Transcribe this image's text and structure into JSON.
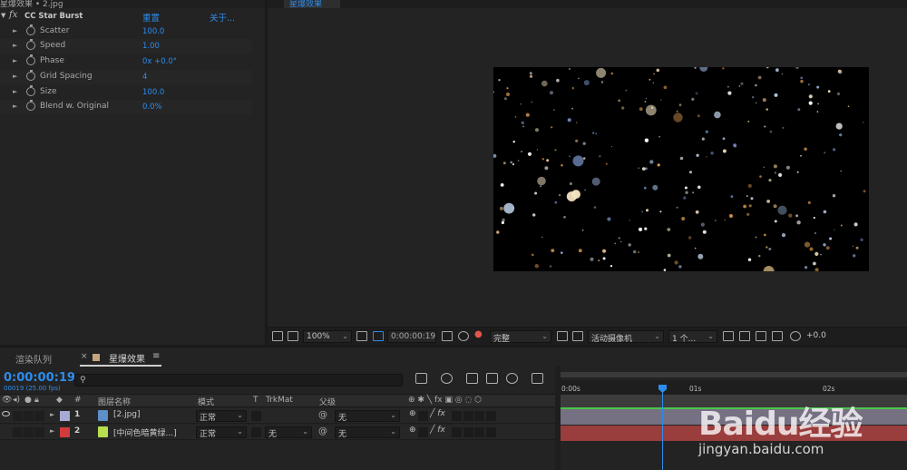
{
  "effect_panel": {
    "tab_title": "星爆效果 • 2.jpg",
    "effect_name": "CC Star Burst",
    "reset_label": "重置",
    "about_label": "关于...",
    "properties": [
      {
        "label": "Scatter",
        "value": "100.0"
      },
      {
        "label": "Speed",
        "value": "1.00"
      },
      {
        "label": "Phase",
        "value": "0x +0.0°"
      },
      {
        "label": "Grid Spacing",
        "value": "4"
      },
      {
        "label": "Size",
        "value": "100.0"
      },
      {
        "label": "Blend w. Original",
        "value": "0.0%"
      }
    ]
  },
  "viewer": {
    "comp_tab": "星爆效果",
    "toolbar": {
      "zoom": "100%",
      "timecode": "0:00:00:19",
      "resolution": "完整",
      "camera": "活动摄像机",
      "views": "1 个...",
      "exposure": "+0.0"
    }
  },
  "timeline": {
    "tab_render_queue": "渲染队列",
    "tab_comp": "星爆效果",
    "timecode": "0:00:00:19",
    "frame_info": "00019 (25.00 fps)",
    "columns": {
      "number": "#",
      "layer_name": "图层名称",
      "mode": "模式",
      "t": "T",
      "trkmat": "TrkMat",
      "parent": "父级"
    },
    "layers": [
      {
        "number": "1",
        "name": "[2.jpg]",
        "mode": "正常",
        "trkmat": "",
        "parent": "无",
        "label_color": "#a9a9d6"
      },
      {
        "number": "2",
        "name": "[中间色暗黄绿...]",
        "mode": "正常",
        "trkmat": "无",
        "parent": "无",
        "label_color": "#d03b3b"
      }
    ],
    "ruler_ticks": [
      "0:00s",
      "01s",
      "02s"
    ]
  },
  "watermark": {
    "brand": "Baidu经验",
    "url": "jingyan.baidu.com"
  },
  "colors": {
    "accent_blue": "#2d8ceb",
    "layer1_track": "#767083",
    "layer2_track": "#9a3d3d",
    "work_area_green": "#49c64a"
  }
}
